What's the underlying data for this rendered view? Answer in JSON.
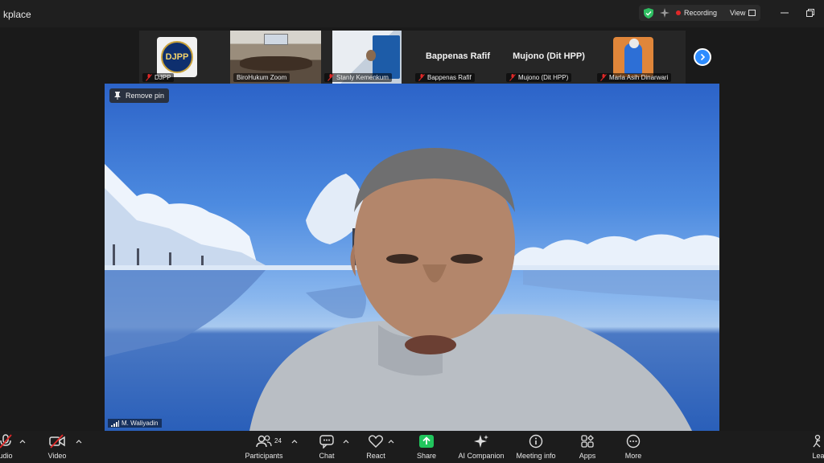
{
  "titlebar": {
    "app_title": "kplace",
    "recording_label": "Recording",
    "view_label": "View",
    "colors": {
      "recording_dot": "#e02828",
      "shield": "#2fbf62"
    }
  },
  "thumbnails": [
    {
      "name": "DJPP",
      "logo_text": "DJPP",
      "muted": true
    },
    {
      "name": "BiroHukum Zoom",
      "muted": false
    },
    {
      "name": "Stanly Kemenkum",
      "muted": true
    },
    {
      "name": "Bappenas Rafif",
      "big_name": "Bappenas Rafif",
      "muted": true
    },
    {
      "name": "Mujono (Dit HPP)",
      "big_name": "Mujono (Dit HPP)",
      "muted": true
    },
    {
      "name": "Maria Asih Dinarwari",
      "muted": true
    }
  ],
  "main": {
    "remove_pin_label": "Remove pin",
    "speaker_name": "M. Waliyadin"
  },
  "toolbar": {
    "audio_label": "udio",
    "video_label": "Video",
    "participants_label": "Participants",
    "participants_count": "24",
    "chat_label": "Chat",
    "react_label": "React",
    "share_label": "Share",
    "ai_label": "AI Companion",
    "meeting_info_label": "Meeting info",
    "apps_label": "Apps",
    "more_label": "More",
    "leave_label": "Lea",
    "colors": {
      "share": "#21c55d",
      "muted": "#e02828"
    }
  }
}
